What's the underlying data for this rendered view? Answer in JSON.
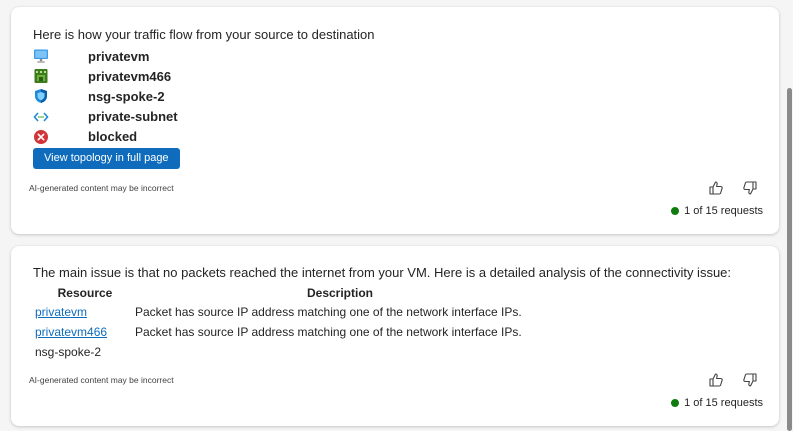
{
  "card1": {
    "intro": "Here is how your traffic flow from your source to destination",
    "flow": [
      {
        "label": "privatevm",
        "icon": "virtual-machine-icon"
      },
      {
        "label": "privatevm466",
        "icon": "network-interface-icon"
      },
      {
        "label": "nsg-spoke-2",
        "icon": "network-security-group-icon"
      },
      {
        "label": "private-subnet",
        "icon": "subnet-icon"
      },
      {
        "label": "blocked",
        "icon": "blocked-icon"
      }
    ],
    "button_label": "View topology in full page",
    "disclaimer": "AI-generated content may be incorrect",
    "status": "1 of 15 requests"
  },
  "card2": {
    "intro": "The main issue is that no packets reached the internet from your VM. Here is a detailed analysis of the connectivity issue:",
    "table": {
      "headers": [
        "Resource",
        "Description"
      ],
      "rows": [
        {
          "resource": "privatevm",
          "description": "Packet has source IP address matching one of the network interface IPs."
        },
        {
          "resource": "privatevm466",
          "description": "Packet has source IP address matching one of the network interface IPs."
        },
        {
          "resource": "nsg-spoke-2",
          "description": ""
        }
      ]
    },
    "disclaimer": "AI-generated content may be incorrect",
    "status": "1 of 15 requests"
  },
  "colors": {
    "accent": "#0f6cbd",
    "status_green": "#107c10",
    "blocked_red": "#d13438"
  }
}
